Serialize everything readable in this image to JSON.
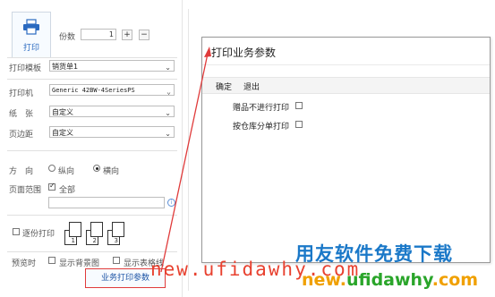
{
  "print_panel": {
    "print_button": "打印",
    "copies_label": "份数",
    "copies_value": "1",
    "plus": "+",
    "minus": "−",
    "template_label": "打印模板",
    "template_value": "销货单1",
    "printer_label": "打印机",
    "printer_value": "Generic 42BW-4SeriesPS",
    "paper_label": "纸　张",
    "paper_value": "自定义",
    "margin_label": "页边距",
    "margin_value": "自定义",
    "orientation_label": "方　向",
    "portrait_label": "纵向",
    "landscape_label": "横向",
    "orientation_selected": "landscape",
    "range_label": "页面范围",
    "range_all_label": "全部",
    "collate_label": "逐份打印",
    "copy_icons": [
      "1",
      "2",
      "3"
    ],
    "preview_label": "预览时",
    "show_bg_label": "显示背景图",
    "show_grid_label": "显示表格线",
    "business_param_button": "业务打印参数"
  },
  "dialog": {
    "title": "打印业务参数",
    "confirm": "确定",
    "exit": "退出",
    "option1": "赠品不进行打印",
    "option2": "按仓库分单打印"
  },
  "watermark": {
    "brand_cn": "用友软件免费下载",
    "url_line": "new.ufidawhy.com",
    "url_line2_a": "new.",
    "url_line2_b": "ufidawhy",
    "url_line2_c": ".com"
  },
  "colors": {
    "accent_blue": "#2a6ac0",
    "highlight_red": "#e03b3b"
  }
}
